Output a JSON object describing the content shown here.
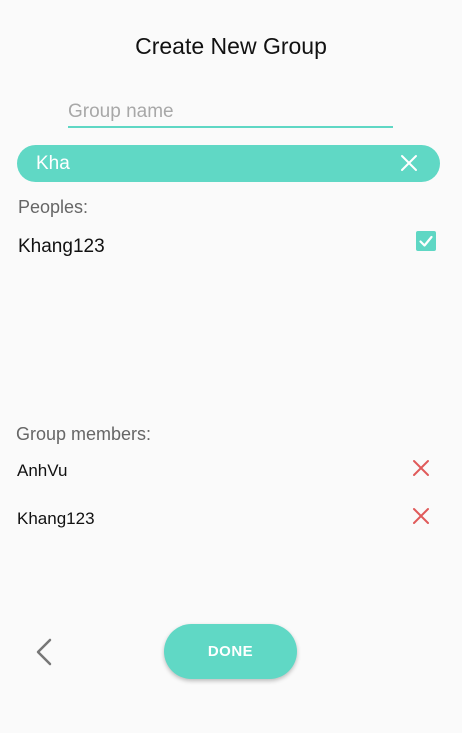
{
  "header": {
    "title": "Create New Group"
  },
  "group_name": {
    "placeholder": "Group name",
    "value": ""
  },
  "search": {
    "query": "Kha",
    "clear_icon": "close-icon"
  },
  "peoples": {
    "label": "Peoples:",
    "items": [
      {
        "name": "Khang123",
        "checked": true
      }
    ]
  },
  "members": {
    "label": "Group members:",
    "items": [
      {
        "name": "AnhVu",
        "remove_icon": "close-icon"
      },
      {
        "name": "Khang123",
        "remove_icon": "close-icon"
      }
    ]
  },
  "footer": {
    "back_icon": "chevron-left-icon",
    "done_label": "DONE"
  },
  "colors": {
    "accent": "#60d8c5",
    "remove": "#e05a5a",
    "background": "#fafafa"
  }
}
